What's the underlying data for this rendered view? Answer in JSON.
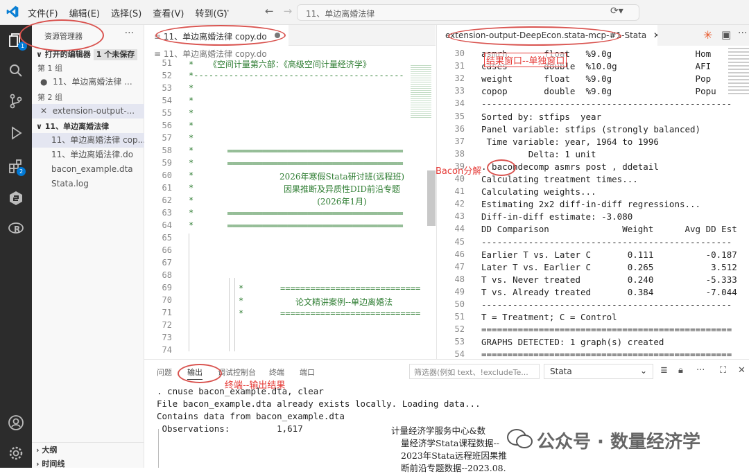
{
  "menu": {
    "file": "文件(F)",
    "edit": "编辑(E)",
    "select": "选择(S)",
    "view": "查看(V)",
    "goto": "转到(G)",
    "more": "···"
  },
  "command_center": {
    "text": "11、单边离婚法律"
  },
  "sidebar": {
    "title": "资源管理器",
    "open_editors": "打开的编辑器",
    "unsaved": "1 个未保存",
    "group1": "第 1 组",
    "group1_file": "11、单边离婚法律 ...",
    "group2": "第 2 组",
    "group2_file": "extension-output-...",
    "folder": "11、单边离婚法律",
    "files": [
      "11、单边离婚法律 cop...",
      "11、单边离婚法律.do",
      "bacon_example.dta",
      "Stata.log"
    ],
    "outline": "大纲",
    "timeline": "时间线",
    "badge_explorer": "1",
    "badge_ext": "2"
  },
  "editor_left": {
    "tab": "11、单边离婚法律 copy.do",
    "breadcrumb": "11、单边离婚法律 copy.do",
    "line_numbers": [
      "51",
      "52",
      "53",
      "54",
      "55",
      "56",
      "57",
      "58",
      "59",
      "60",
      "61",
      "62",
      "63",
      "64",
      "65",
      "66",
      "67",
      "68",
      "69",
      "70",
      "71",
      "72",
      "73",
      "74"
    ],
    "line51": "*   《空间计量第六部：《高级空间计量经济学》",
    "line52": "*------------------------------------------",
    "star": "*",
    "rule": "═══════════════════════════════════",
    "title1": "2026年寒假Stata研讨班(远程班)",
    "title2": "因果推断及异质性DID前沿专题",
    "title3": "(2026年1月)",
    "eq_rule": "============================",
    "case_title": "论文精讲案例--单边离婚法"
  },
  "editor_right": {
    "tab": "extension-output-DeepEcon.stata-mcp-#1-Stata",
    "annotation_window": "结果窗口--单独窗口",
    "annotation_bacon": "Bacon分解",
    "lines": [
      {
        "n": "30",
        "t": "asmrh       float   %9.0g                Hom"
      },
      {
        "n": "31",
        "t": "cases       double  %10.0g               AFI"
      },
      {
        "n": "32",
        "t": "weight      float   %9.0g                Pop"
      },
      {
        "n": "33",
        "t": "copop       double  %9.0g                Popu"
      },
      {
        "n": "34",
        "t": "------------------------------------------------"
      },
      {
        "n": "35",
        "t": "Sorted by: stfips  year"
      },
      {
        "n": "36",
        "t": "Panel variable: stfips (strongly balanced)"
      },
      {
        "n": "37",
        "t": " Time variable: year, 1964 to 1996"
      },
      {
        "n": "38",
        "t": "         Delta: 1 unit"
      },
      {
        "n": "39",
        "t": ". bacondecomp asmrs post , ddetail"
      },
      {
        "n": "40",
        "t": "Calculating treatment times..."
      },
      {
        "n": "41",
        "t": "Calculating weights..."
      },
      {
        "n": "42",
        "t": "Estimating 2x2 diff-in-diff regressions..."
      },
      {
        "n": "43",
        "t": "Diff-in-diff estimate: -3.080"
      },
      {
        "n": "44",
        "t": "DD Comparison              Weight      Avg DD Est"
      },
      {
        "n": "45",
        "t": "------------------------------------------------"
      },
      {
        "n": "46",
        "t": "Earlier T vs. Later C       0.111          -0.187"
      },
      {
        "n": "47",
        "t": "Later T vs. Earlier C       0.265           3.512"
      },
      {
        "n": "48",
        "t": "T vs. Never treated         0.240          -5.333"
      },
      {
        "n": "49",
        "t": "T vs. Already treated       0.384          -7.044"
      },
      {
        "n": "50",
        "t": "------------------------------------------------"
      },
      {
        "n": "51",
        "t": "T = Treatment; C = Control"
      },
      {
        "n": "52",
        "t": "================================================"
      },
      {
        "n": "53",
        "t": "GRAPHS DETECTED: 1 graph(s) created"
      },
      {
        "n": "54",
        "t": "================================================"
      }
    ]
  },
  "panel": {
    "tabs": [
      "问题",
      "输出",
      "调试控制台",
      "终端",
      "端口"
    ],
    "filter_placeholder": "筛选器(例如 text、!excludeTe...",
    "channel": "Stata",
    "annotation": "终端--输出结果",
    "terminal": [
      ". cnuse bacon_example.dta, clear",
      "File bacon_example.dta already exists locally. Loading data...",
      "Contains data from bacon_example.dta",
      " Observations:         1,617"
    ],
    "side_text": [
      "计量经济学服务中心&数",
      "量经济学Stata课程数据--",
      "2023年Stata远程班因果推",
      "断前沿专题数据--2023.08."
    ],
    "watermark": "公众号 · 数量经济学"
  },
  "colors": {
    "accent": "#0078d4",
    "annotation": "#e53935",
    "code_green": "#2e7d32"
  }
}
